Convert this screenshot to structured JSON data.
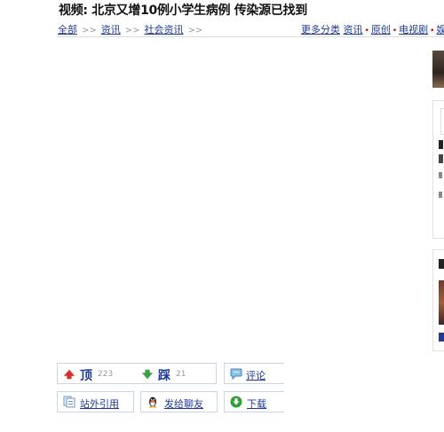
{
  "page": {
    "title": "视频: 北京又增10例小学生病例  传染源已找到"
  },
  "breadcrumb": {
    "items": [
      "全部",
      "资讯",
      "社会资讯"
    ],
    "separator": ">>"
  },
  "category_links": {
    "more_label": "更多分类",
    "items": [
      "资讯",
      "原创",
      "电视剧",
      "娱"
    ]
  },
  "actions": {
    "vote_up": {
      "label": "顶",
      "count": "223"
    },
    "vote_down": {
      "label": "踩",
      "count": "21"
    },
    "comment_label": "评论",
    "cite_label": "站外引用",
    "share_label": "发给聊友",
    "download_label": "下载"
  },
  "colors": {
    "link": "#1f3a93",
    "border": "#c7d7e9",
    "up_arrow": "#d9302c",
    "down_arrow": "#3aa245"
  },
  "icons": {
    "vote_up": "red-up-arrow-icon",
    "vote_down": "green-down-arrow-icon",
    "comment": "speech-bubble-icon",
    "cite": "document-icon",
    "share": "qq-penguin-icon",
    "download": "green-download-circle-icon"
  }
}
